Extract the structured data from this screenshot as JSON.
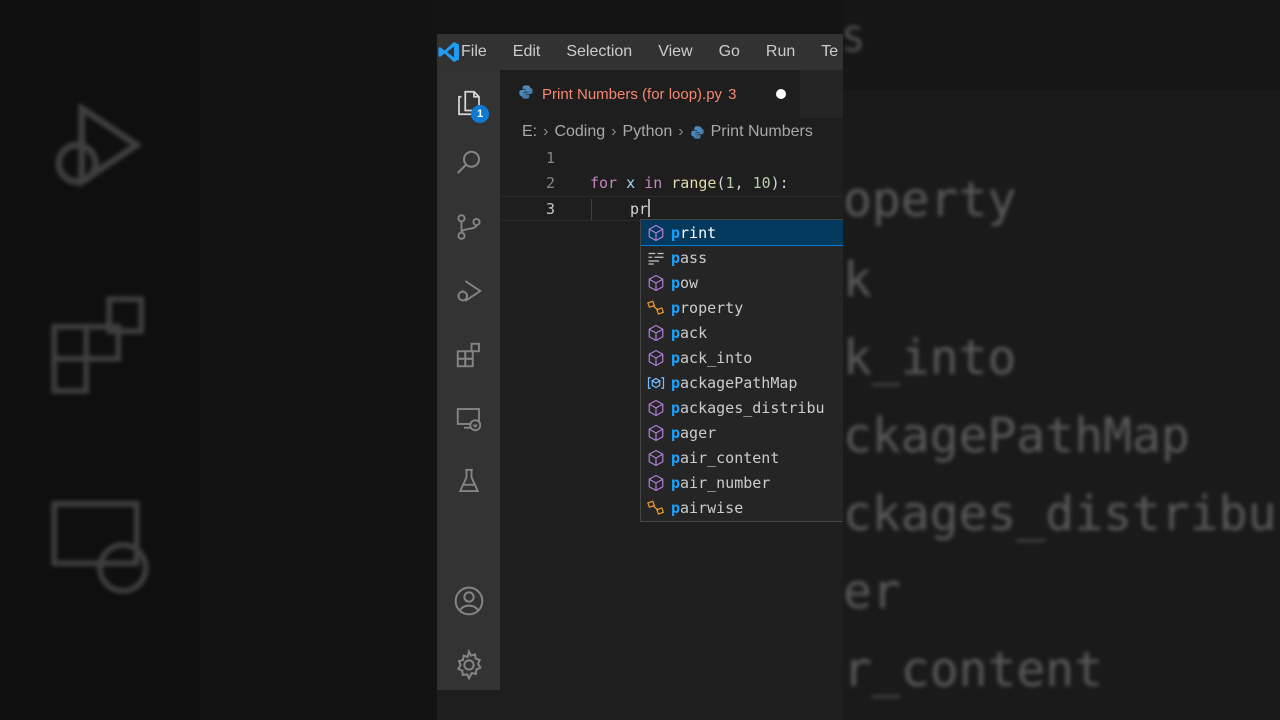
{
  "menu": {
    "items": [
      "File",
      "Edit",
      "Selection",
      "View",
      "Go",
      "Run",
      "Te"
    ]
  },
  "activity_bar": {
    "explorer_badge": "1",
    "icons": [
      "files-icon",
      "search-icon",
      "source-control-icon",
      "run-debug-icon",
      "extensions-icon",
      "remote-explorer-icon",
      "testing-icon",
      "account-icon",
      "settings-gear-icon"
    ]
  },
  "tab": {
    "filename": "Print Numbers (for loop).py",
    "problem_count": "3",
    "modified": true
  },
  "breadcrumb": {
    "items": [
      "E:",
      "Coding",
      "Python",
      "Print Numbers"
    ]
  },
  "code": {
    "lines": [
      {
        "number": "1",
        "text": ""
      },
      {
        "number": "2",
        "text": "for x in range(1, 10):"
      },
      {
        "number": "3",
        "text": "pr"
      }
    ],
    "line2": {
      "kw_for": "for",
      "var": "x",
      "kw_in": "in",
      "fn": "range",
      "open": "(",
      "n1": "1",
      "comma": ", ",
      "n2": "10",
      "close": "):"
    },
    "line3_typed": "pr"
  },
  "suggestions": [
    {
      "label": "print",
      "match": "p",
      "rest": "rint",
      "kind": "function",
      "selected": true
    },
    {
      "label": "pass",
      "match": "p",
      "rest": "ass",
      "kind": "keyword"
    },
    {
      "label": "pow",
      "match": "p",
      "rest": "ow",
      "kind": "function"
    },
    {
      "label": "property",
      "match": "p",
      "rest": "roperty",
      "kind": "class"
    },
    {
      "label": "pack",
      "match": "p",
      "rest": "ack",
      "kind": "function"
    },
    {
      "label": "pack_into",
      "match": "p",
      "rest": "ack_into",
      "kind": "function"
    },
    {
      "label": "packagePathMap",
      "match": "p",
      "rest": "ackagePathMap",
      "kind": "variable"
    },
    {
      "label": "packages_distribu",
      "match": "p",
      "rest": "ackages_distribu",
      "kind": "function"
    },
    {
      "label": "pager",
      "match": "p",
      "rest": "ager",
      "kind": "function"
    },
    {
      "label": "pair_content",
      "match": "p",
      "rest": "air_content",
      "kind": "function"
    },
    {
      "label": "pair_number",
      "match": "p",
      "rest": "air_number",
      "kind": "function"
    },
    {
      "label": "pairwise",
      "match": "p",
      "rest": "airwise",
      "kind": "class"
    }
  ],
  "background": {
    "right_text": [
      "operty",
      "k",
      "k_into",
      "ckagePathMap",
      "ckages_distribu",
      "er",
      "r_content"
    ],
    "right_top_text": "S"
  },
  "colors": {
    "accent": "#007fd4",
    "badge": "#0e7ad3",
    "tab_error_text": "#f48771",
    "match_highlight": "#18a3ff",
    "function_icon": "#b180d7",
    "class_icon": "#ee9d28",
    "variable_icon": "#75beff"
  }
}
